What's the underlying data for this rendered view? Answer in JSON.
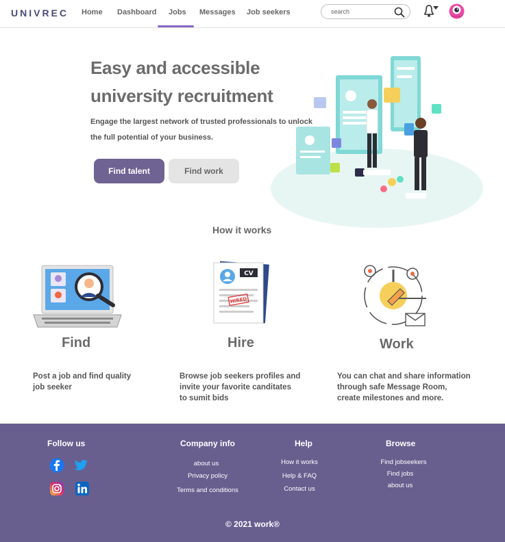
{
  "nav": {
    "logo": "UNIVREC",
    "links": [
      "Home",
      "Dashboard",
      "Jobs",
      "Messages",
      "Job seekers"
    ],
    "active": "Jobs",
    "search_placeholder": "search"
  },
  "hero": {
    "title_line1": "Easy and accessible",
    "title_line2": "university recruitment",
    "sub_line1": "Engage the largest network of trusted professionals to unlock",
    "sub_line2": "the full potential of your business.",
    "primary_button": "Find talent",
    "secondary_button": "Find work"
  },
  "how_title": "How it works",
  "features": [
    {
      "title": "Find",
      "desc": "Post a job and find quality\njob seeker"
    },
    {
      "title": "Hire",
      "desc": "Browse job seekers profiles and\ninvite your favorite canditates\n to sumit bids"
    },
    {
      "title": "Work",
      "desc": "You can chat and share information\nthrough safe Message Room,\n create milestones and more."
    }
  ],
  "illus_text": {
    "cv": "CV",
    "hired": "HIRED"
  },
  "footer": {
    "follow": "Follow us",
    "company": {
      "title": "Company info",
      "links": [
        "about us",
        "Privacy policy",
        "Terms and conditions"
      ]
    },
    "help": {
      "title": "Help",
      "links": [
        "How it works",
        "Help & FAQ",
        "Contact us"
      ]
    },
    "browse": {
      "title": "Browse",
      "links": [
        "Find jobseekers",
        "Find jobs",
        "about us"
      ]
    },
    "copyright": "©  2021 work®"
  },
  "colors": {
    "accent": "#6e6392",
    "footer_bg": "#685f8f",
    "active_tab": "#8a66c4"
  }
}
